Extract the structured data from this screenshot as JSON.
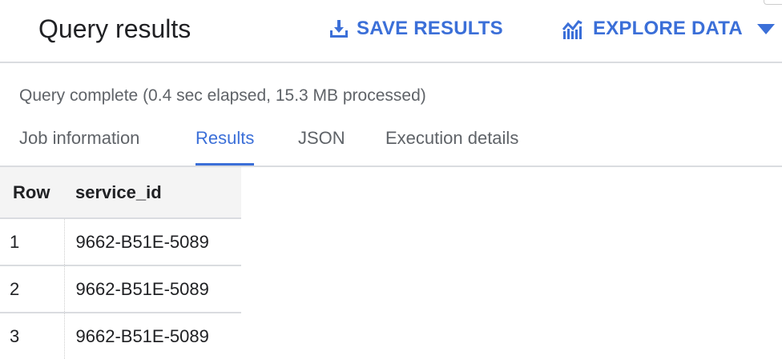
{
  "header": {
    "title": "Query results",
    "save_label": "SAVE RESULTS",
    "explore_label": "EXPLORE DATA"
  },
  "status": "Query complete (0.4 sec elapsed, 15.3 MB processed)",
  "tabs": [
    {
      "label": "Job information"
    },
    {
      "label": "Results"
    },
    {
      "label": "JSON"
    },
    {
      "label": "Execution details"
    }
  ],
  "table": {
    "columns": [
      "Row",
      "service_id"
    ],
    "rows": [
      [
        "1",
        "9662-B51E-5089"
      ],
      [
        "2",
        "9662-B51E-5089"
      ],
      [
        "3",
        "9662-B51E-5089"
      ]
    ]
  },
  "colors": {
    "accent": "#3b6fd8"
  }
}
